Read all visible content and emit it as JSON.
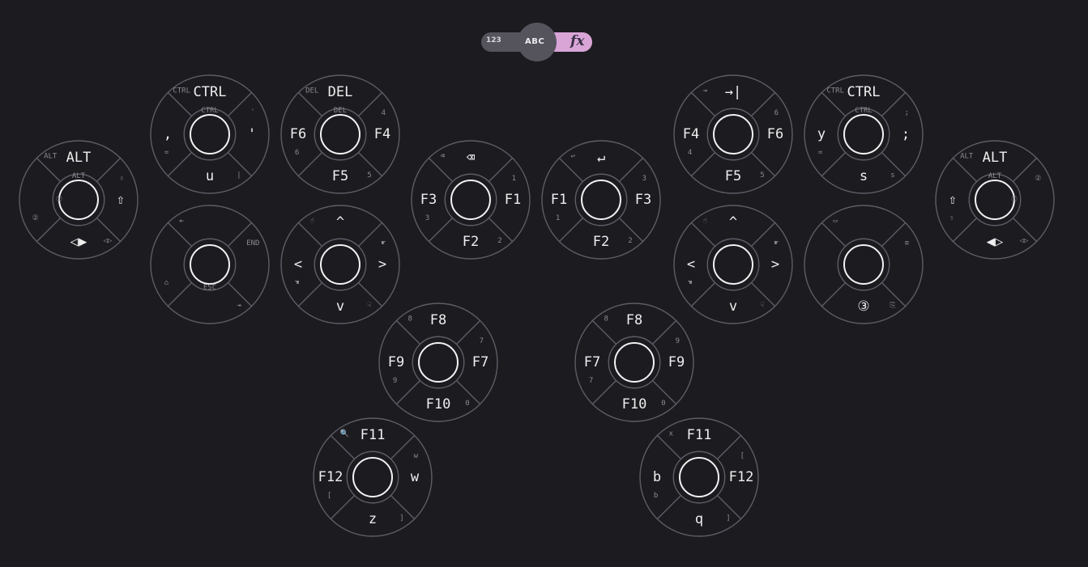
{
  "mode_toggle": {
    "options": [
      "123",
      "ABC",
      "fx"
    ],
    "active": "fx"
  },
  "keys": [
    {
      "id": "left-alt-shift",
      "up": "ALT",
      "up_sub": "ALT",
      "up_center": "ALT",
      "right": "⇧",
      "right_sub": "⇧",
      "down": "◁▶",
      "down_sub": "◁▷",
      "left": "",
      "left_sub": "②",
      "left_center": "①"
    },
    {
      "id": "left-ctrl-u",
      "up": "CTRL",
      "up_sub": "CTRL",
      "up_center": "CTRL",
      "right": "'",
      "right_sub": "`",
      "down": "u",
      "down_sub": "|",
      "left": ",",
      "left_sub": "="
    },
    {
      "id": "left-del-f4",
      "up": "DEL",
      "up_sub": "DEL",
      "up_center": "DEL",
      "right": "F4",
      "right_sub": "4",
      "down": "F5",
      "down_sub": "5",
      "left": "F6",
      "left_sub": "6"
    },
    {
      "id": "left-backspace-f1",
      "up": "⌫",
      "up_sub": "⌫",
      "right": "F1",
      "right_sub": "1",
      "down": "F2",
      "down_sub": "2",
      "left": "F3",
      "left_sub": "3"
    },
    {
      "id": "left-nav",
      "up": "",
      "up_sub": "⇤",
      "right": "",
      "right_sub": "END",
      "down": "",
      "down_sub": "⇥",
      "left": "",
      "left_sub": "⌂",
      "down_center": "ESC"
    },
    {
      "id": "left-arrows",
      "up": "^",
      "up_sub": "☝",
      "right": ">",
      "right_sub": "☛",
      "down": "v",
      "down_sub": "☟",
      "left": "<",
      "left_sub": "☚"
    },
    {
      "id": "left-f8",
      "up": "F8",
      "up_sub": "8",
      "right": "F7",
      "right_sub": "7",
      "down": "F10",
      "down_sub": "0",
      "left": "F9",
      "left_sub": "9"
    },
    {
      "id": "left-f11",
      "up": "F11",
      "up_sub": "🔍",
      "right": "w",
      "right_sub": "w",
      "down": "z",
      "down_sub": "]",
      "left": "F12",
      "left_sub": "["
    },
    {
      "id": "right-enter-f1",
      "up": "↵",
      "up_sub": "↩",
      "right": "F3",
      "right_sub": "3",
      "down": "F2",
      "down_sub": "2",
      "left": "F1",
      "left_sub": "1"
    },
    {
      "id": "right-f8",
      "up": "F8",
      "up_sub": "8",
      "right": "F9",
      "right_sub": "9",
      "down": "F10",
      "down_sub": "0",
      "left": "F7",
      "left_sub": "7"
    },
    {
      "id": "right-f11",
      "up": "F11",
      "up_sub": "x",
      "right": "F12",
      "right_sub": "[",
      "down": "q",
      "down_sub": "]",
      "left": "b",
      "left_sub": "b"
    },
    {
      "id": "right-tab-f6",
      "up": "→|",
      "up_sub": "⇥",
      "right": "F6",
      "right_sub": "6",
      "down": "F5",
      "down_sub": "5",
      "left": "F4",
      "left_sub": "4"
    },
    {
      "id": "right-arrows",
      "up": "^",
      "up_sub": "☝",
      "right": ">",
      "right_sub": "☛",
      "down": "v",
      "down_sub": "☟",
      "left": "<",
      "left_sub": "☚"
    },
    {
      "id": "right-ctrl-s",
      "up": "CTRL",
      "up_sub": "CTRL",
      "up_center": "CTRL",
      "right": ";",
      "right_sub": ";",
      "down": "s",
      "down_sub": "s",
      "left": "y",
      "left_sub": "="
    },
    {
      "id": "right-misc",
      "up": "",
      "up_sub": "▭",
      "right": "",
      "right_sub": "≡",
      "down": "③",
      "down_sub": "⎘",
      "left": "",
      "left_sub": ""
    },
    {
      "id": "right-alt-shift",
      "up": "ALT",
      "up_sub": "ALT",
      "up_center": "ALT",
      "right": "",
      "right_sub": "②",
      "down": "◀▷",
      "down_sub": "◁▷",
      "left": "⇧",
      "left_sub": "⇧",
      "right_center": "①"
    }
  ]
}
